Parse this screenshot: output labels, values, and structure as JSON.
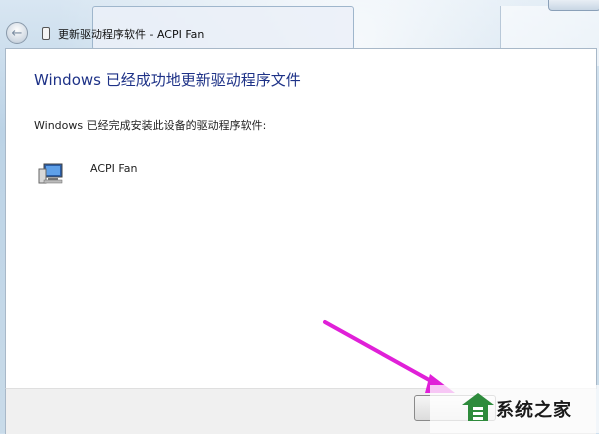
{
  "window": {
    "title": "更新驱动程序软件 - ACPI Fan"
  },
  "main": {
    "heading": "Windows 已经成功地更新驱动程序文件",
    "description": "Windows 已经完成安装此设备的驱动程序软件:",
    "device_name": "ACPI Fan"
  },
  "footer": {
    "close_label": ""
  },
  "watermark": {
    "text": "系统之家"
  },
  "colors": {
    "heading": "#1e3287",
    "arrow": "#e020d8"
  }
}
